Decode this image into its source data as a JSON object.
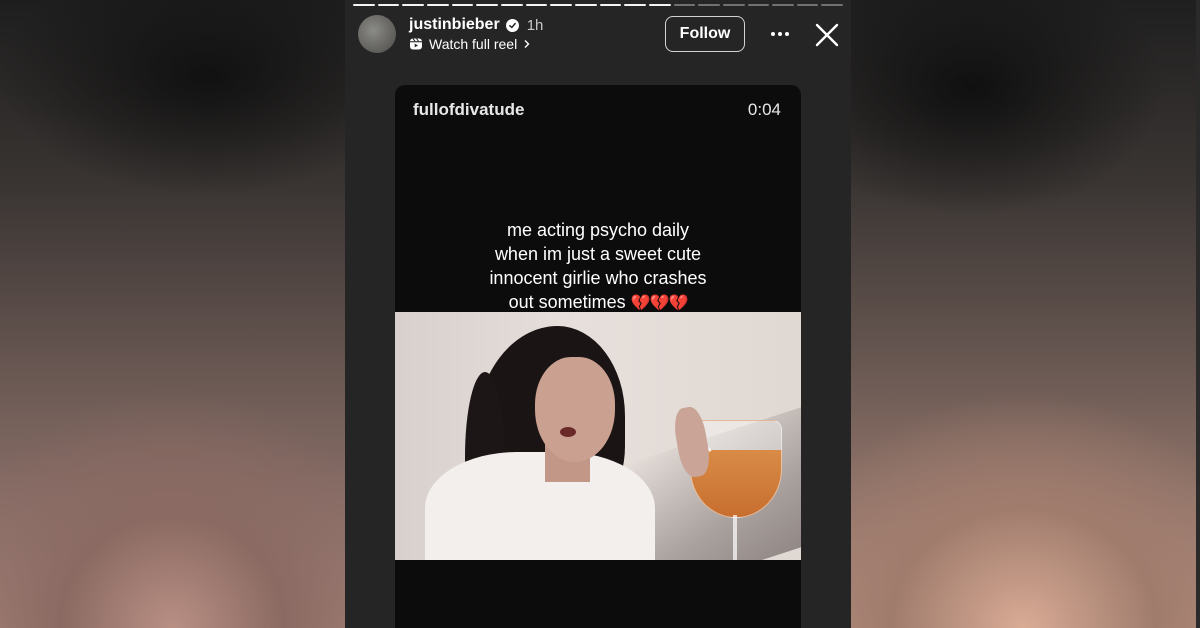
{
  "header": {
    "username": "justinbieber",
    "verified_icon": "verified-badge-icon",
    "time_ago": "1h",
    "reel_link_label": "Watch full reel",
    "follow_label": "Follow",
    "progress": {
      "segments": 20,
      "completed": 13
    }
  },
  "reel_card": {
    "source_username": "fullofdivatude",
    "duration": "0:04",
    "caption_lines": [
      "me acting psycho daily",
      "when im just a sweet cute",
      "innocent girlie who crashes",
      "out sometimes"
    ],
    "caption_emoji": "💔💔💔"
  },
  "icons": {
    "reel": "reels-icon",
    "chevron": "chevron-right-icon",
    "more": "more-options-icon",
    "close": "close-icon"
  },
  "colors": {
    "story_background": "#252525",
    "card_background": "#0c0c0d",
    "text": "#ffffff",
    "heart": "#e0203a"
  }
}
